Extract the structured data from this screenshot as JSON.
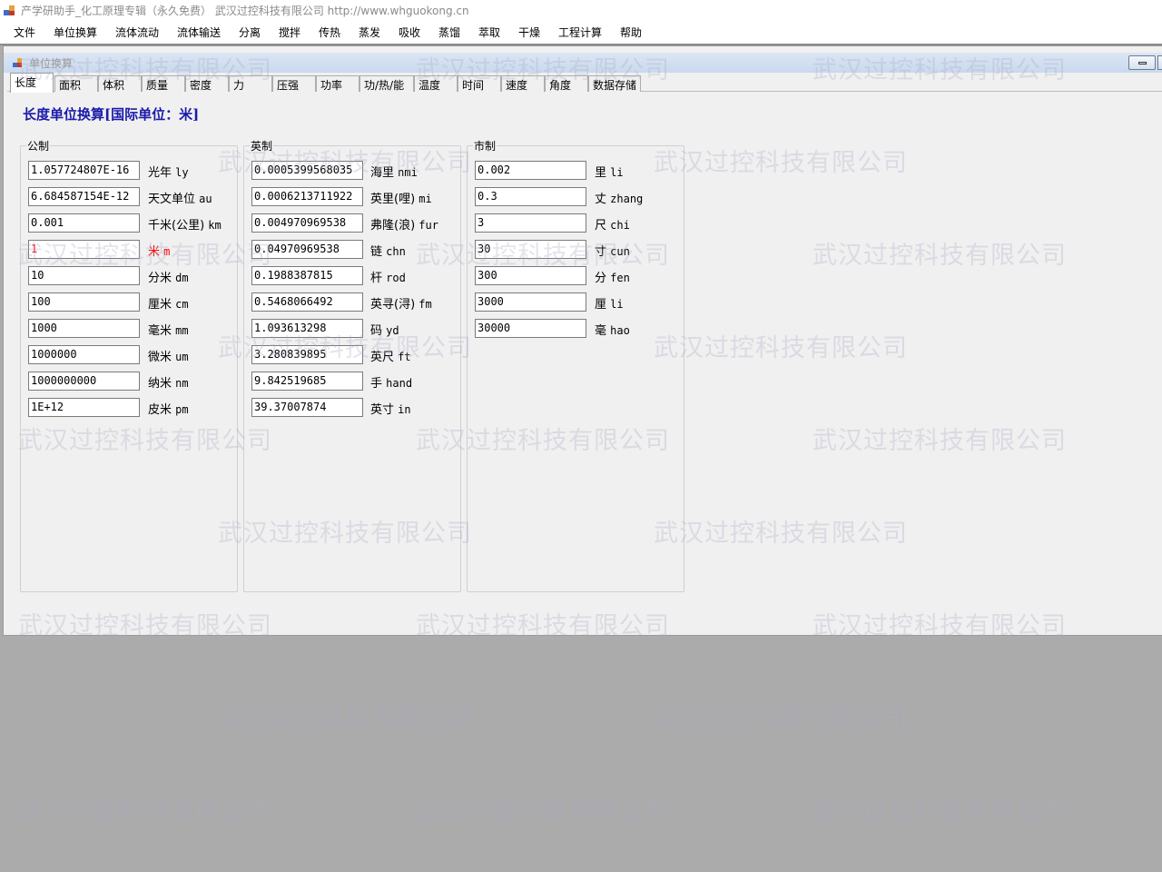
{
  "window": {
    "title": "产学研助手_化工原理专辑（永久免费）        武汉过控科技有限公司   http://www.whguokong.cn"
  },
  "menu": [
    "文件",
    "单位换算",
    "流体流动",
    "流体输送",
    "分离",
    "搅拌",
    "传热",
    "蒸发",
    "吸收",
    "蒸馏",
    "萃取",
    "干燥",
    "工程计算",
    "帮助"
  ],
  "child_window": {
    "title": "单位换算"
  },
  "tabs": [
    "长度",
    "面积",
    "体积",
    "质量",
    "密度",
    "力",
    "压强",
    "功率",
    "功/热/能",
    "温度",
    "时间",
    "速度",
    "角度",
    "数据存储"
  ],
  "active_tab": "长度",
  "heading": "长度单位换算[国际单位：米]",
  "groups": {
    "metric": {
      "label": "公制",
      "rows": [
        {
          "value": "1.057724807E-16",
          "unit": "光年",
          "abbr": "ly"
        },
        {
          "value": "6.684587154E-12",
          "unit": "天文单位",
          "abbr": "au"
        },
        {
          "value": "0.001",
          "unit": "千米(公里)",
          "abbr": "km"
        },
        {
          "value": "1",
          "unit": "米",
          "abbr": "m"
        },
        {
          "value": "10",
          "unit": "分米",
          "abbr": "dm"
        },
        {
          "value": "100",
          "unit": "厘米",
          "abbr": "cm"
        },
        {
          "value": "1000",
          "unit": "毫米",
          "abbr": "mm"
        },
        {
          "value": "1000000",
          "unit": "微米",
          "abbr": "um"
        },
        {
          "value": "1000000000",
          "unit": "纳米",
          "abbr": "nm"
        },
        {
          "value": "1E+12",
          "unit": "皮米",
          "abbr": "pm"
        }
      ]
    },
    "imperial": {
      "label": "英制",
      "rows": [
        {
          "value": "0.0005399568035",
          "unit": "海里",
          "abbr": "nmi"
        },
        {
          "value": "0.0006213711922",
          "unit": "英里(哩)",
          "abbr": "mi"
        },
        {
          "value": "0.004970969538",
          "unit": "弗隆(浪)",
          "abbr": "fur"
        },
        {
          "value": "0.04970969538",
          "unit": "链",
          "abbr": "chn"
        },
        {
          "value": "0.1988387815",
          "unit": "杆",
          "abbr": "rod"
        },
        {
          "value": "0.5468066492",
          "unit": "英寻(浔)",
          "abbr": "fm"
        },
        {
          "value": "1.093613298",
          "unit": "码",
          "abbr": "yd"
        },
        {
          "value": "3.280839895",
          "unit": "英尺",
          "abbr": "ft"
        },
        {
          "value": "9.842519685",
          "unit": "手",
          "abbr": "hand"
        },
        {
          "value": "39.37007874",
          "unit": "英寸",
          "abbr": "in"
        }
      ]
    },
    "chinese": {
      "label": "市制",
      "rows": [
        {
          "value": "0.002",
          "unit": "里",
          "abbr": "li"
        },
        {
          "value": "0.3",
          "unit": "丈",
          "abbr": "zhang"
        },
        {
          "value": "3",
          "unit": "尺",
          "abbr": "chi"
        },
        {
          "value": "30",
          "unit": "寸",
          "abbr": "cun"
        },
        {
          "value": "300",
          "unit": "分",
          "abbr": "fen"
        },
        {
          "value": "3000",
          "unit": "厘",
          "abbr": "li"
        },
        {
          "value": "30000",
          "unit": "毫",
          "abbr": "hao"
        }
      ]
    }
  },
  "watermark": "武汉过控科技有限公司",
  "colors": {
    "heading": "#1a1aaa",
    "highlight": "#ff0000",
    "mdi_background": "#ababab"
  }
}
